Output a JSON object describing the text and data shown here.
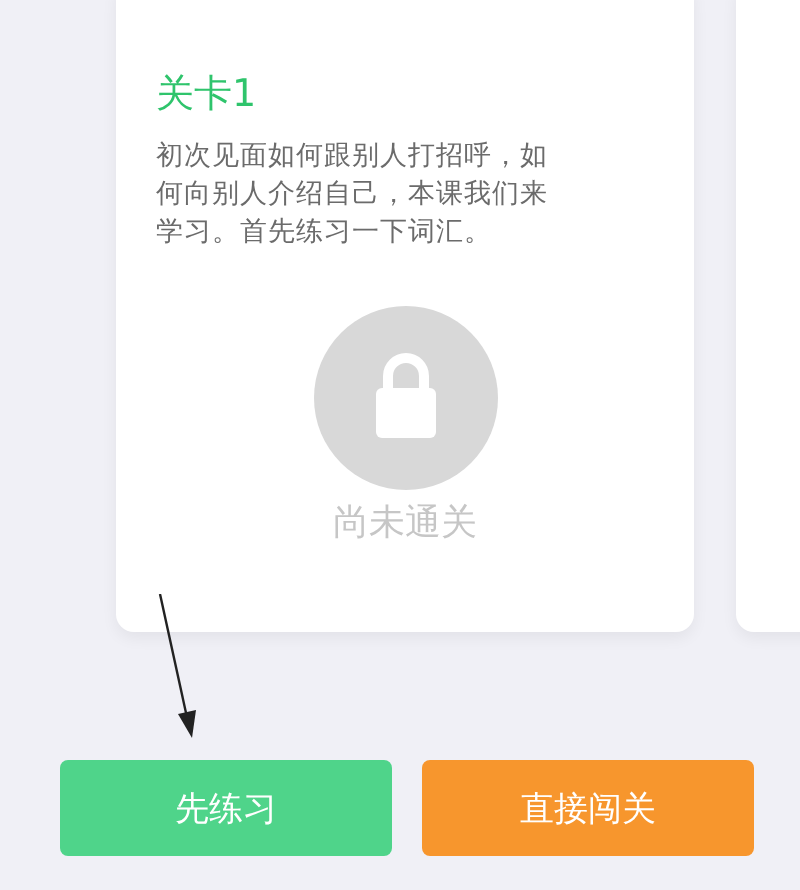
{
  "level_card": {
    "title": "关卡1",
    "description": "初次见面如何跟别人打招呼，如何向别人介绍自己，本课我们来学习。首先练习一下词汇。",
    "locked": true,
    "status": "尚未通关"
  },
  "buttons": [
    {
      "label": "先练习",
      "kind": "practice"
    },
    {
      "label": "直接闯关",
      "kind": "challenge"
    }
  ],
  "annotation_arrow": true
}
